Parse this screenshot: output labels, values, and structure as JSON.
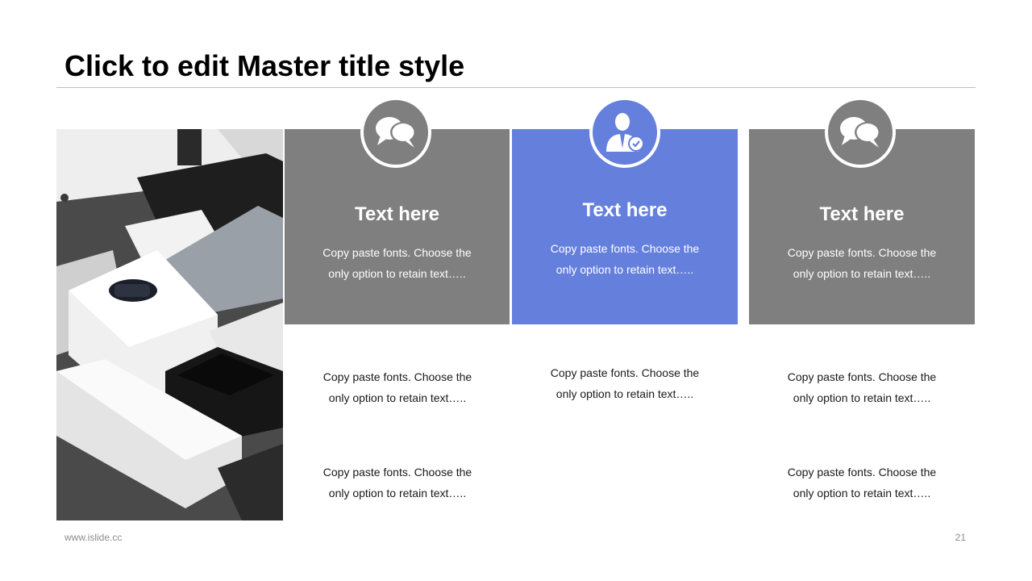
{
  "slide": {
    "title": "Click to edit Master title style",
    "footer_url": "www.islide.cc",
    "page_number": "21"
  },
  "colors": {
    "gray_card": "#7f7f7f",
    "accent_card": "#6580dc",
    "text_dark": "#1a1a1a"
  },
  "columns": [
    {
      "icon": "speech-bubbles-icon",
      "heading": "Text here",
      "card_text": [
        "Copy paste fonts. Choose the",
        "only option to retain text….."
      ],
      "lower_texts": [
        [
          "Copy paste fonts. Choose the",
          "only option to retain text….."
        ],
        [
          "Copy paste fonts. Choose the",
          "only option to retain text….."
        ]
      ]
    },
    {
      "icon": "businessman-check-icon",
      "heading": "Text here",
      "card_text": [
        "Copy paste fonts. Choose the",
        "only option to retain text….."
      ],
      "lower_texts": [
        [
          "Copy paste fonts. Choose the",
          "only option to retain text….."
        ]
      ]
    },
    {
      "icon": "speech-bubbles-icon",
      "heading": "Text here",
      "card_text": [
        "Copy paste fonts. Choose the",
        "only option to retain text….."
      ],
      "lower_texts": [
        [
          "Copy paste fonts. Choose the",
          "only option to retain text….."
        ],
        [
          "Copy paste fonts. Choose the",
          "only option to retain text….."
        ]
      ]
    }
  ]
}
